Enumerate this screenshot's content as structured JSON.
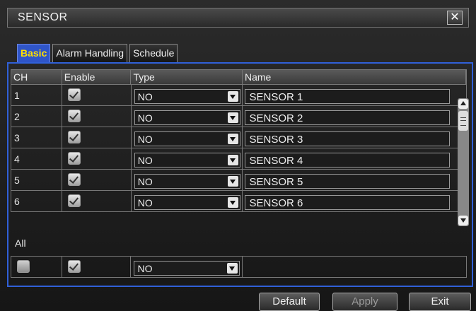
{
  "window": {
    "title": "SENSOR",
    "close_glyph": "✕"
  },
  "tabs": [
    {
      "label": "Basic",
      "active": true
    },
    {
      "label": "Alarm Handling",
      "active": false
    },
    {
      "label": "Schedule",
      "active": false
    }
  ],
  "table": {
    "headers": {
      "ch": "CH",
      "enable": "Enable",
      "type": "Type",
      "name": "Name"
    },
    "rows": [
      {
        "ch": "1",
        "enabled": true,
        "type": "NO",
        "name": "SENSOR 1"
      },
      {
        "ch": "2",
        "enabled": true,
        "type": "NO",
        "name": "SENSOR 2"
      },
      {
        "ch": "3",
        "enabled": true,
        "type": "NO",
        "name": "SENSOR 3"
      },
      {
        "ch": "4",
        "enabled": true,
        "type": "NO",
        "name": "SENSOR 4"
      },
      {
        "ch": "5",
        "enabled": true,
        "type": "NO",
        "name": "SENSOR 5"
      },
      {
        "ch": "6",
        "enabled": true,
        "type": "NO",
        "name": "SENSOR 6"
      }
    ]
  },
  "all": {
    "label": "All",
    "select_all": false,
    "enabled": true,
    "type": "NO"
  },
  "buttons": {
    "default": "Default",
    "apply": "Apply",
    "exit": "Exit"
  },
  "colors": {
    "accent": "#2f55c8",
    "active_tab_text": "#ffe000",
    "panel_border": "#3060d8"
  },
  "icons": {
    "close": "close-icon",
    "check": "checkmark-icon",
    "dropdown": "chevron-down-icon",
    "scroll_up": "scroll-up-icon",
    "scroll_down": "scroll-down-icon"
  }
}
